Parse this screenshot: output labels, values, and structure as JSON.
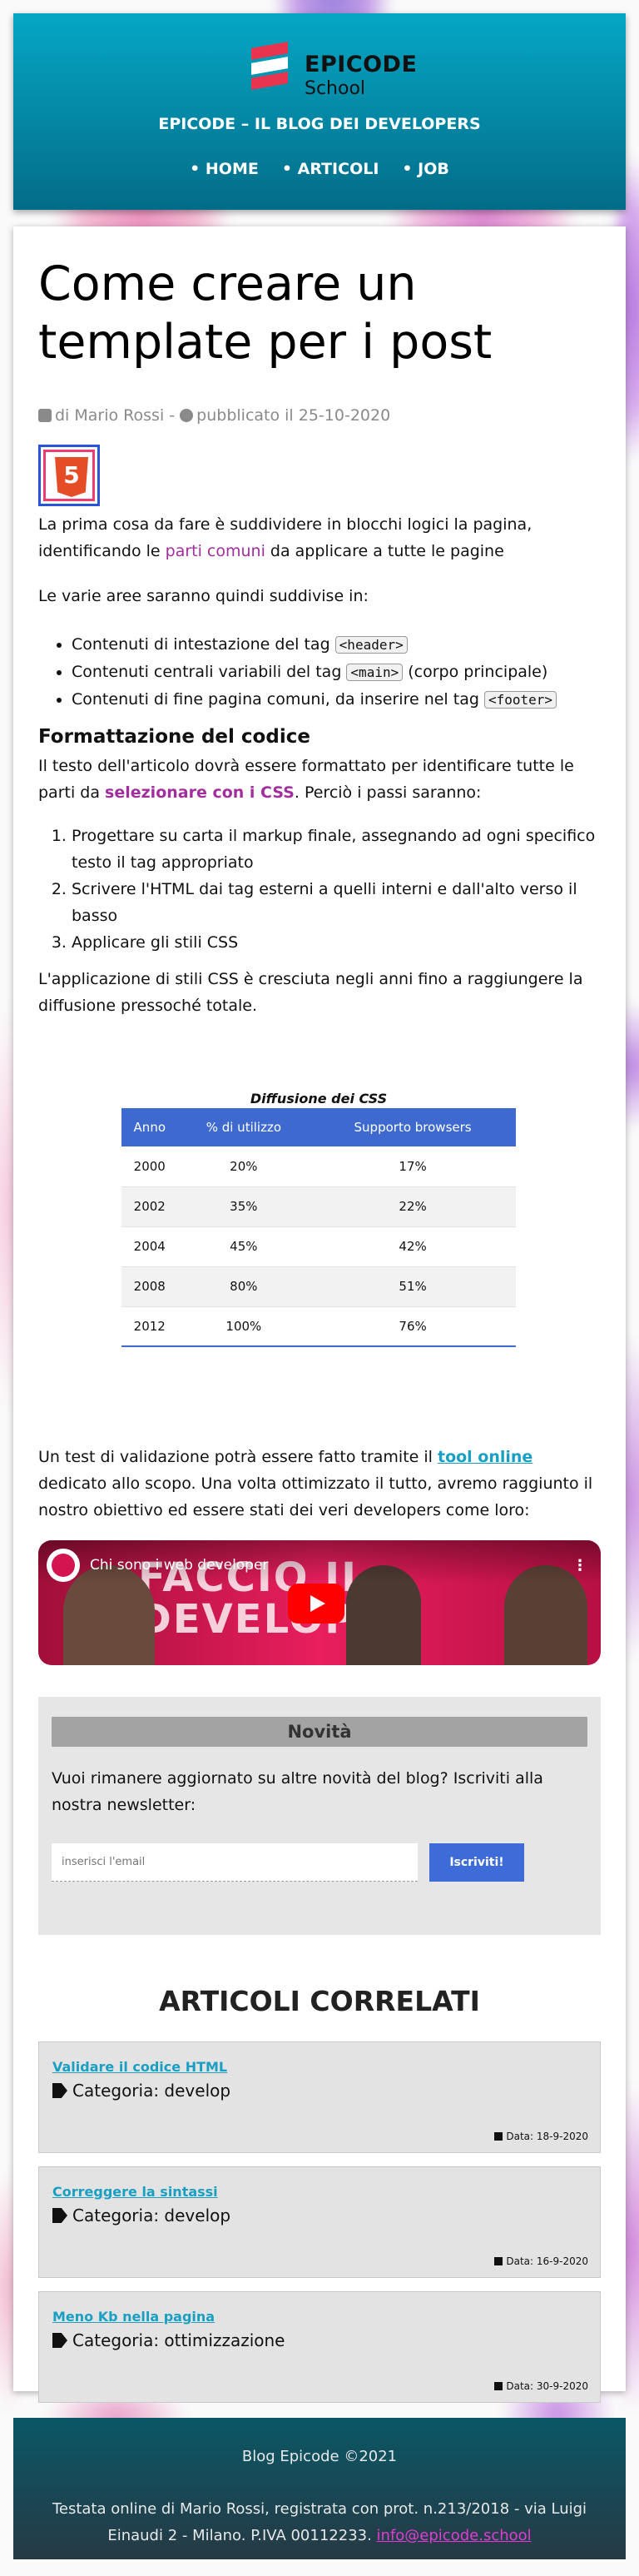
{
  "brand": {
    "logo_title": "EPICODE",
    "logo_subtitle": "School",
    "blog_title": "EPICODE – IL BLOG DEI DEVELOPERS",
    "colors": {
      "header": "#05a7c5",
      "accent": "#3d6cd8",
      "link": "#1a9fc2",
      "highlight": "#a12e9c"
    }
  },
  "nav": {
    "home": "HOME",
    "articoli": "ARTICOLI",
    "job": "JOB"
  },
  "post": {
    "title": "Come creare un template per i post",
    "author": "di Mario Rossi",
    "sep": "-",
    "published": "pubblicato il 25-10-2020",
    "html5_icon": "html5-logo",
    "intro_1": "La prima cosa da fare è suddividere in blocchi logici la pagina, identificando le ",
    "intro_link": "parti comuni",
    "intro_2": " da applicare a tutte le pagine",
    "areas_intro": "Le varie aree saranno quindi suddivise in:",
    "areas": [
      {
        "pre": "Contenuti di intestazione del tag ",
        "code": "<header>",
        "post": ""
      },
      {
        "pre": "Contenuti centrali variabili del tag ",
        "code": "<main>",
        "post": " (corpo principale)"
      },
      {
        "pre": "Contenuti di fine pagina comuni, da inserire nel tag ",
        "code": "<footer>",
        "post": ""
      }
    ],
    "format_heading": "Formattazione del codice",
    "format_1": "Il testo dell'articolo dovrà essere formattato per identificare tutte le parti da ",
    "format_link": "selezionare con i CSS",
    "format_2": ". Perciò i passi saranno:",
    "steps": [
      "Progettare su carta il markup finale, assegnando ad ogni specifico testo il tag appropriato",
      "Scrivere l'HTML dai tag esterni a quelli interni e dall'alto verso il basso",
      "Applicare gli stili CSS"
    ],
    "css_paragraph": "L'applicazione di stili CSS è cresciuta negli anni fino a raggiungere la diffusione pressoché totale.",
    "table": {
      "caption": "Diffusione dei CSS",
      "headers": [
        "Anno",
        "% di utilizzo",
        "Supporto browsers"
      ],
      "rows": [
        [
          "2000",
          "20%",
          "17%"
        ],
        [
          "2002",
          "35%",
          "22%"
        ],
        [
          "2004",
          "45%",
          "42%"
        ],
        [
          "2008",
          "80%",
          "51%"
        ],
        [
          "2012",
          "100%",
          "76%"
        ]
      ]
    },
    "validation_1": "Un test di validazione potrà essere fatto tramite il ",
    "validation_link": "tool online",
    "validation_2": " dedicato allo scopo. Una volta ottimizzato il tutto, avremo raggiunto il nostro obiettivo ed essere stati dei veri developers come loro:",
    "video": {
      "title": "Chi sono i web developer",
      "overlay_text": "FACCIO IL DEVELOPER"
    }
  },
  "newsletter": {
    "heading": "Novità",
    "text": "Vuoi rimanere aggiornato su altre novità del blog? Iscriviti alla nostra newsletter:",
    "placeholder": "inserisci l'email",
    "button": "Iscriviti!"
  },
  "related": {
    "title": "ARTICOLI CORRELATI",
    "items": [
      {
        "link": "Validare il codice HTML",
        "category": "Categoria: develop",
        "date": "Data: 18-9-2020"
      },
      {
        "link": "Correggere la sintassi",
        "category": "Categoria: develop",
        "date": "Data: 16-9-2020"
      },
      {
        "link": "Meno Kb nella pagina",
        "category": "Categoria: ottimizzazione",
        "date": "Data: 30-9-2020"
      }
    ]
  },
  "footer": {
    "copyright": "Blog Epicode ©2021",
    "info": "Testata online di Mario Rossi, registrata con prot. n.213/2018 - via Luigi Einaudi 2 - Milano. P.IVA 00112233. ",
    "email": "info@epicode.school"
  }
}
